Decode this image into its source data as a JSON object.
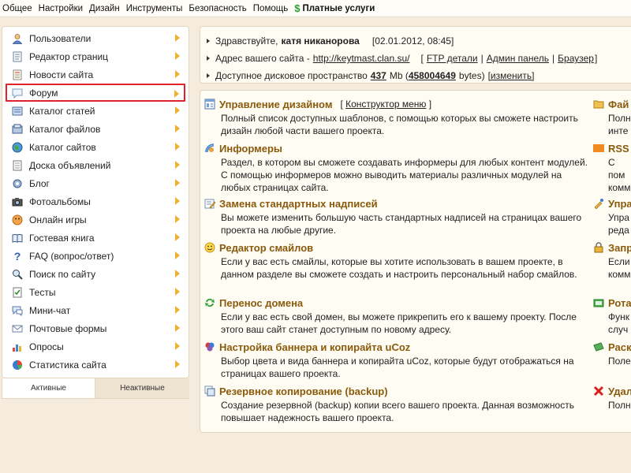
{
  "topmenu": {
    "items": [
      "Общее",
      "Настройки",
      "Дизайн",
      "Инструменты",
      "Безопасность",
      "Помощь"
    ],
    "paid": "Платные услуги"
  },
  "sidebar": {
    "items": [
      {
        "label": "Пользователи",
        "icon": "user-icon"
      },
      {
        "label": "Редактор страниц",
        "icon": "page-icon"
      },
      {
        "label": "Новости сайта",
        "icon": "news-icon"
      },
      {
        "label": "Форум",
        "icon": "forum-icon"
      },
      {
        "label": "Каталог статей",
        "icon": "articles-icon"
      },
      {
        "label": "Каталог файлов",
        "icon": "files-icon"
      },
      {
        "label": "Каталог сайтов",
        "icon": "globe-icon"
      },
      {
        "label": "Доска объявлений",
        "icon": "board-icon"
      },
      {
        "label": "Блог",
        "icon": "blog-icon"
      },
      {
        "label": "Фотоальбомы",
        "icon": "camera-icon"
      },
      {
        "label": "Онлайн игры",
        "icon": "games-icon"
      },
      {
        "label": "Гостевая книга",
        "icon": "book-icon"
      },
      {
        "label": "FAQ (вопрос/ответ)",
        "icon": "faq-icon"
      },
      {
        "label": "Поиск по сайту",
        "icon": "search-icon"
      },
      {
        "label": "Тесты",
        "icon": "tests-icon"
      },
      {
        "label": "Мини-чат",
        "icon": "chat-icon"
      },
      {
        "label": "Почтовые формы",
        "icon": "mail-icon"
      },
      {
        "label": "Опросы",
        "icon": "poll-icon"
      },
      {
        "label": "Статистика сайта",
        "icon": "stats-icon"
      }
    ],
    "tabs": {
      "active": "Активные",
      "inactive": "Неактивные"
    }
  },
  "info": {
    "greeting": "Здравствуйте,",
    "username": "катя никанорова",
    "datetime": "[02.01.2012, 08:45]",
    "address_label": "Адрес вашего сайта -",
    "address": "http://keytmast.clan.su/",
    "open_bracket": "[",
    "ftp": "FTP детали",
    "sep1": "|",
    "admin": "Админ панель",
    "sep2": "|",
    "browser": "Браузер",
    "close_bracket": "]",
    "disk_label": "Доступное дисковое пространство",
    "disk_used": "437",
    "disk_unit": "Mb (",
    "disk_bytes": "458004649",
    "disk_bytes_unit": "bytes)",
    "change": "[изменить]"
  },
  "main": {
    "sections": [
      {
        "title": "Управление дизайном",
        "extra_open": "[",
        "extra_link": "Конструктор меню",
        "extra_close": "]",
        "desc": "Полный список доступных шаблонов, с помощью которых вы сможете настроить дизайн любой части вашего проекта.",
        "icon": "design-icon"
      },
      {
        "title": "Информеры",
        "desc": "Раздел, в котором вы сможете создавать информеры для любых контент модулей. С помощью информеров можно выводить материалы различных модулей на любых страницах сайта.",
        "icon": "informer-icon"
      },
      {
        "title": "Замена стандартных надписей",
        "desc": "Вы можете изменить большую часть стандартных надписей на страницах вашего проекта на любые другие.",
        "icon": "replace-icon"
      },
      {
        "title": "Редактор смайлов",
        "desc": "Если у вас есть смайлы, которые вы хотите использовать в вашем проекте, в данном разделе вы сможете создать и настроить персональный набор смайлов.",
        "icon": "smile-icon"
      },
      {
        "title": "Перенос домена",
        "desc": "Если у вас есть свой домен, вы можете прикрепить его к вашему проекту. После этого ваш сайт станет доступным по новому адресу.",
        "icon": "domain-icon"
      },
      {
        "title": "Настройка баннера и копирайта uCoz",
        "desc": "Выбор цвета и вида баннера и копирайта uCoz, которые будут отображаться на страницах вашего проекта.",
        "icon": "banner-icon"
      },
      {
        "title": "Резервное копирование (backup)",
        "desc": "Создание резервной (backup) копии всего вашего проекта. Данная возможность повышает надежность вашего проекта.",
        "icon": "backup-icon"
      }
    ],
    "right_sections": [
      {
        "title": "Фай",
        "desc": "Полн инте",
        "icon": "folder-icon"
      },
      {
        "title": "RSS",
        "desc": "С пом комм",
        "icon": "rss-icon"
      },
      {
        "title": "Упра",
        "desc": "Упра реда",
        "icon": "manage-icon"
      },
      {
        "title": "Запр",
        "desc": "Если комм",
        "icon": "lock-icon"
      },
      {
        "title": "Рота",
        "desc": "Функ случ",
        "icon": "rotate-icon"
      },
      {
        "title": "Раск",
        "desc": "Поле",
        "icon": "promo-icon"
      },
      {
        "title": "Удал",
        "desc": "Полн",
        "icon": "delete-icon"
      }
    ]
  },
  "colors": {
    "accent_title": "#8a5a0c",
    "active_border": "#e0222a",
    "arrow": "#f0b030",
    "background": "#f5ecdd"
  }
}
